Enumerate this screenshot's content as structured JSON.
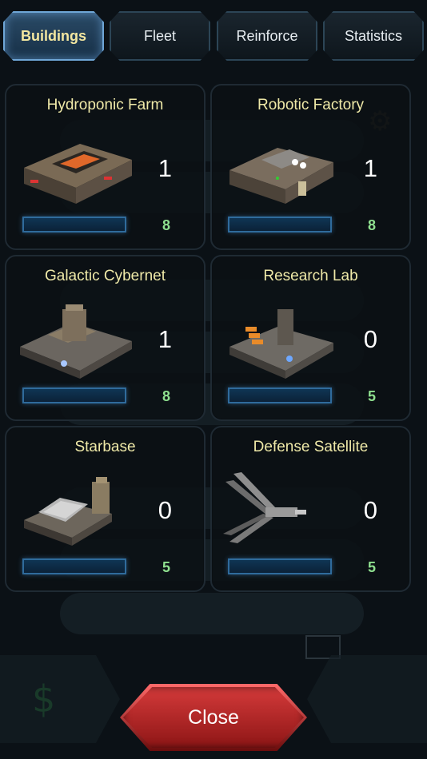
{
  "tabs": [
    {
      "label": "Buildings",
      "active": true
    },
    {
      "label": "Fleet",
      "active": false
    },
    {
      "label": "Reinforce",
      "active": false
    },
    {
      "label": "Statistics",
      "active": false
    }
  ],
  "buildings": [
    {
      "name": "Hydroponic Farm",
      "count": "1",
      "cost": "8",
      "icon": "hydroponic-farm-icon"
    },
    {
      "name": "Robotic Factory",
      "count": "1",
      "cost": "8",
      "icon": "robotic-factory-icon"
    },
    {
      "name": "Galactic Cybernet",
      "count": "1",
      "cost": "8",
      "icon": "galactic-cybernet-icon"
    },
    {
      "name": "Research Lab",
      "count": "0",
      "cost": "5",
      "icon": "research-lab-icon"
    },
    {
      "name": "Starbase",
      "count": "0",
      "cost": "5",
      "icon": "starbase-icon"
    },
    {
      "name": "Defense Satellite",
      "count": "0",
      "cost": "5",
      "icon": "defense-satellite-icon"
    }
  ],
  "close_label": "Close",
  "colors": {
    "title": "#efe9a8",
    "cost": "#8fe08f",
    "tab_active_text": "#f3e7a0",
    "close_red": "#c62a2a"
  }
}
